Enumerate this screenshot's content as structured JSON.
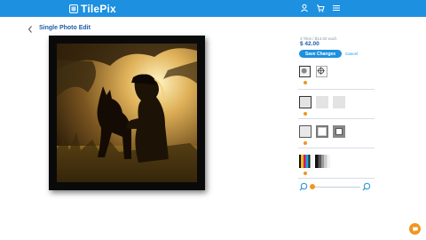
{
  "header": {
    "brand": "TilePix",
    "icons": [
      "user-icon",
      "cart-icon",
      "menu-icon"
    ],
    "bg_color": "#1e90e0"
  },
  "page": {
    "title": "Single Photo Edit",
    "back_icon": "chevron-left-icon"
  },
  "photo": {
    "description_icon": "photo-tile"
  },
  "order": {
    "tiles_line": "3 Tiles / $14.00 each",
    "total": "$ 42.00",
    "save_label": "Save Changes",
    "cancel_label": "Cancel"
  },
  "options": {
    "crop": [
      "crop-fit-icon",
      "crop-crosshair-icon"
    ],
    "frame": [
      "frame-black",
      "frame-white",
      "frame-none"
    ],
    "border": [
      "border-thin",
      "border-medium",
      "border-thick"
    ],
    "filter": [
      "filter-color",
      "filter-bw"
    ]
  },
  "zoom": {
    "level": 0.0
  },
  "colors": {
    "accent": "#f0961e",
    "brand": "#1e90e0",
    "title": "#1e5da8"
  }
}
